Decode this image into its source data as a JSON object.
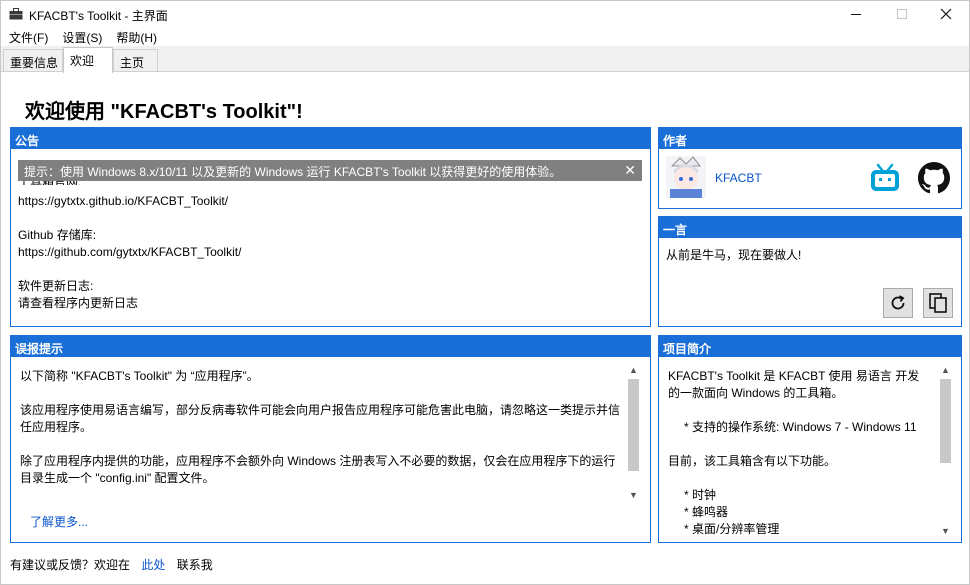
{
  "window": {
    "title": "KFACBT's Toolkit - 主界面",
    "controls": {
      "minimize_icon": "minimize-icon",
      "maximize_icon": "maximize-icon",
      "close_icon": "close-icon"
    }
  },
  "menu": [
    {
      "label": "文件(F)"
    },
    {
      "label": "设置(S)"
    },
    {
      "label": "帮助(H)"
    }
  ],
  "tabs": [
    {
      "label": "重要信息",
      "active": false
    },
    {
      "label": "欢迎",
      "active": true
    },
    {
      "label": "主页",
      "active": false
    }
  ],
  "page": {
    "heading": "欢迎使用 \"KFACBT's Toolkit\"!"
  },
  "announcement": {
    "title": "公告",
    "banner_text": "提示：使用 Windows 8.x/10/11 以及更新的 Windows 运行 KFACBT's Toolkit 以获得更好的使用体验。",
    "banner_close": "✕",
    "partial_line": "工具箱官网:",
    "website_url": "https://gytxtx.github.io/KFACBT_Toolkit/",
    "repo_label": "Github 存储库:",
    "repo_url": "https://github.com/gytxtx/KFACBT_Toolkit/",
    "changelog_label": "软件更新日志:",
    "changelog_text": "请查看程序内更新日志"
  },
  "author": {
    "title": "作者",
    "name": "KFACBT",
    "bilibili_icon": "bilibili-icon",
    "github_icon": "github-icon"
  },
  "quote": {
    "title": "一言",
    "text": "从前是牛马，现在要做人!",
    "refresh_icon": "refresh-icon",
    "copy_icon": "copy-icon"
  },
  "false_positive": {
    "title": "误报提示",
    "p1": "以下简称 \"KFACBT's Toolkit\" 为 “应用程序”。",
    "p2": "该应用程序使用易语言编写，部分反病毒软件可能会向用户报告应用程序可能危害此电脑，请忽略这一类提示并信任应用程序。",
    "p3": "除了应用程序内提供的功能，应用程序不会额外向 Windows 注册表写入不必要的数据，仅会在应用程序下的运行目录生成一个 \"config.ini\" 配置文件。",
    "learn_more": "了解更多..."
  },
  "project": {
    "title": "项目简介",
    "intro_line1": "KFACBT's Toolkit 是 KFACBT 使用 易语言 开发",
    "intro_line2": "的一款面向 Windows 的工具箱。",
    "os_line": "* 支持的操作系统: Windows 7 - Windows 11",
    "features_intro": "目前，该工具箱含有以下功能。",
    "features": [
      "* 时钟",
      "* 蜂鸣器",
      "* 桌面/分辨率管理"
    ]
  },
  "footer": {
    "prefix": "有建议或反馈？欢迎在",
    "link": "此处",
    "suffix": "联系我"
  },
  "colors": {
    "panel_header": "#1a6ed8",
    "banner_bg": "#808080",
    "link": "#0a55cc",
    "bilibili": "#00a1d6"
  }
}
